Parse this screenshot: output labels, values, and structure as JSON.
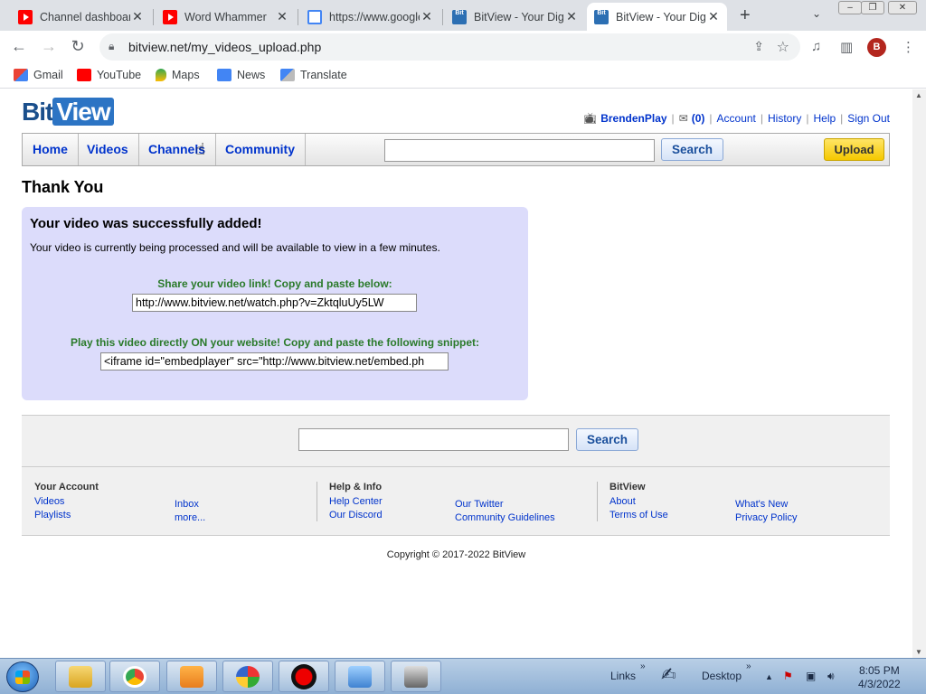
{
  "browser": {
    "tabs": [
      {
        "title": "Channel dashboard",
        "favicon": "youtube-icon"
      },
      {
        "title": "Word Whammer",
        "favicon": "youtube-icon"
      },
      {
        "title": "https://www.google",
        "favicon": "google-icon"
      },
      {
        "title": "BitView - Your Dig",
        "favicon": "bitview-icon"
      },
      {
        "title": "BitView - Your Dig",
        "favicon": "bitview-icon",
        "active": true
      }
    ],
    "url": "bitview.net/my_videos_upload.php",
    "bookmarks": [
      "Gmail",
      "YouTube",
      "Maps",
      "News",
      "Translate"
    ],
    "profile_initial": "B"
  },
  "site": {
    "logo_bit": "Bit",
    "logo_view": "View",
    "user": {
      "username": "BrendenPlay",
      "inbox_count": "(0)",
      "links": [
        "Account",
        "History",
        "Help",
        "Sign Out"
      ]
    },
    "nav": [
      "Home",
      "Videos",
      "Channels",
      "Community"
    ],
    "search_button": "Search",
    "upload_button": "Upload"
  },
  "main": {
    "title": "Thank You",
    "success_heading": "Your video was successfully added!",
    "processing_text": "Your video is currently being processed and will be available to view in a few minutes.",
    "share_label": "Share your video link! Copy and paste below:",
    "share_value": "http://www.bitview.net/watch.php?v=ZktqluUy5LW",
    "embed_label": "Play this video directly ON your website! Copy and paste the following snippet:",
    "embed_value": "<iframe id=\"embedplayer\" src=\"http://www.bitview.net/embed.ph"
  },
  "footer": {
    "search_button": "Search",
    "account": {
      "heading": "Your Account",
      "links": [
        "Videos",
        "Playlists",
        "Inbox",
        "more..."
      ]
    },
    "help": {
      "heading": "Help & Info",
      "links": [
        "Help Center",
        "Our Discord",
        "Our Twitter",
        "Community Guidelines"
      ]
    },
    "bitview": {
      "heading": "BitView",
      "links": [
        "About",
        "Terms of Use",
        "What's New",
        "Privacy Policy"
      ]
    },
    "copyright": "Copyright © 2017-2022 BitView"
  },
  "taskbar": {
    "links_label": "Links",
    "desktop_label": "Desktop",
    "time": "8:05 PM",
    "date": "4/3/2022"
  }
}
